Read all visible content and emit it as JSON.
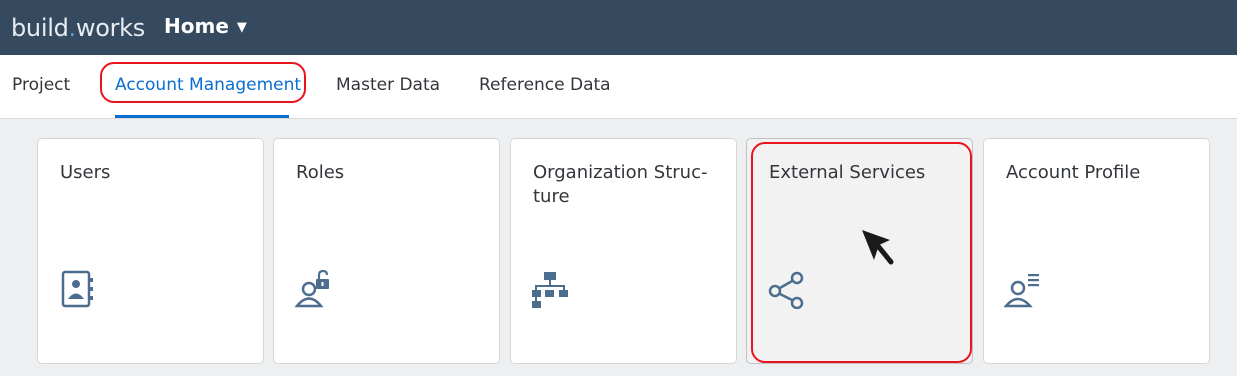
{
  "shellbar": {
    "brand_part1": "build",
    "brand_dot": ".",
    "brand_part2": "works",
    "menu_label": "Home"
  },
  "tabs": [
    {
      "label": "Project",
      "active": false
    },
    {
      "label": "Account Management",
      "active": true
    },
    {
      "label": "Master Data",
      "active": false
    },
    {
      "label": "Reference Data",
      "active": false
    }
  ],
  "tiles": [
    {
      "title": "Users",
      "icon": "address-book-icon"
    },
    {
      "title": "Roles",
      "icon": "user-unlock-icon"
    },
    {
      "title": "Organization Struc-\nture",
      "icon": "org-chart-icon"
    },
    {
      "title": "External Services",
      "icon": "share-icon"
    },
    {
      "title": "Account Profile",
      "icon": "user-profile-icon"
    }
  ],
  "colors": {
    "shellbar": "#354a5f",
    "accent": "#0a6ed1",
    "icon": "#4d6d8f",
    "annotation": "#e8141e"
  }
}
